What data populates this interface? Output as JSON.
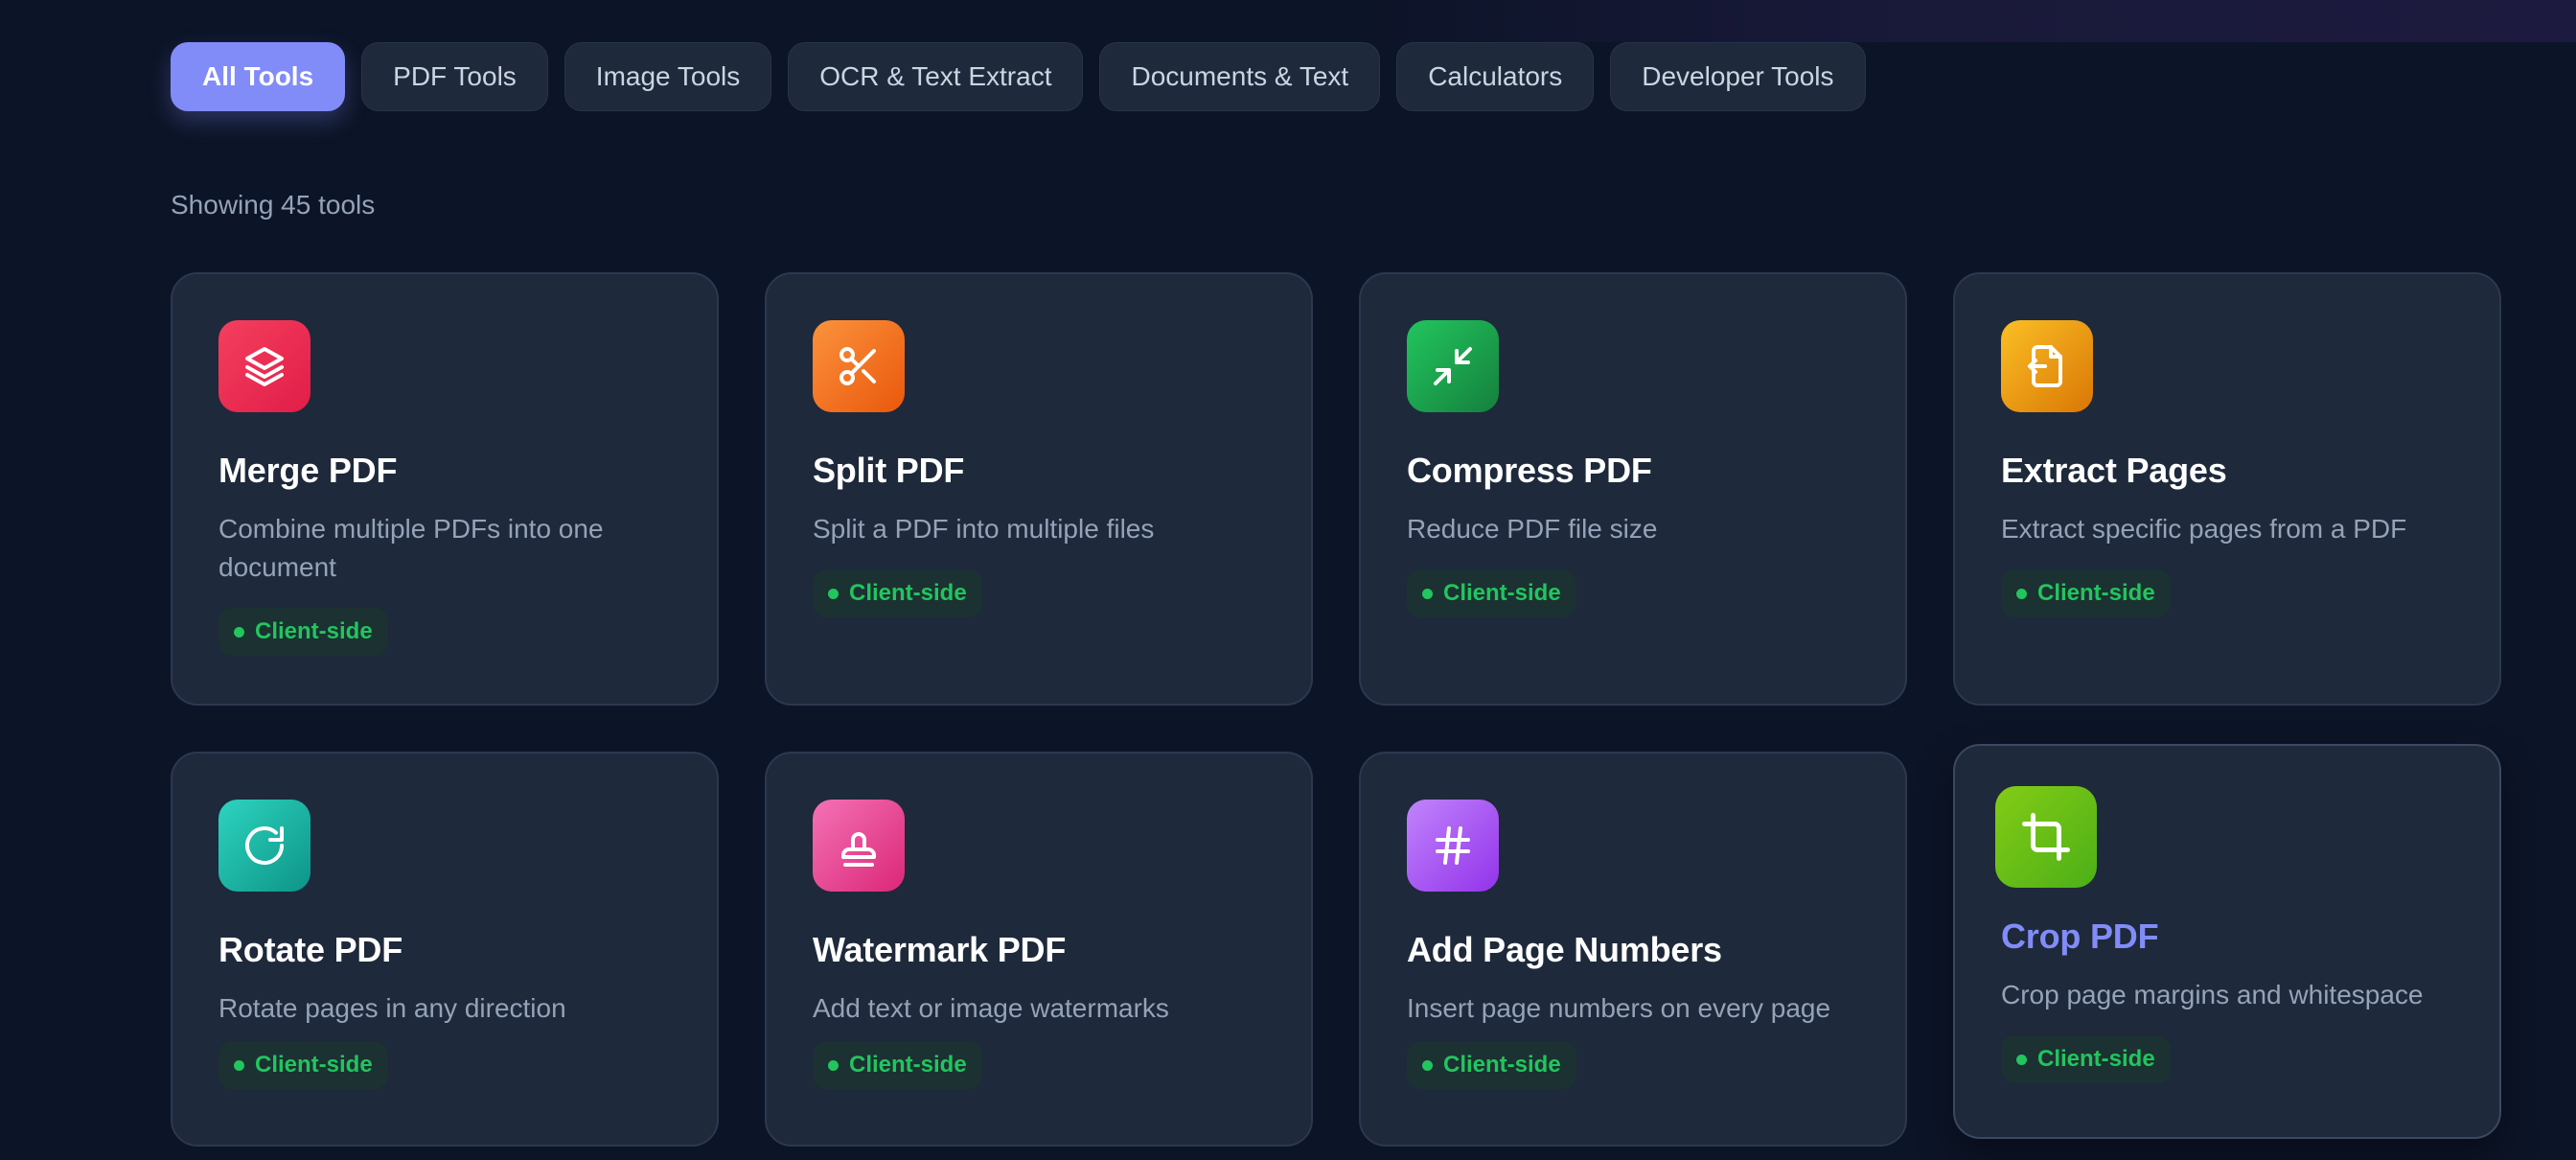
{
  "tabs": [
    {
      "label": "All Tools",
      "active": true
    },
    {
      "label": "PDF Tools",
      "active": false
    },
    {
      "label": "Image Tools",
      "active": false
    },
    {
      "label": "OCR & Text Extract",
      "active": false
    },
    {
      "label": "Documents & Text",
      "active": false
    },
    {
      "label": "Calculators",
      "active": false
    },
    {
      "label": "Developer Tools",
      "active": false
    }
  ],
  "results_count_text": "Showing 45 tools",
  "badge_label": "Client-side",
  "colors": {
    "accent": "#818cf8",
    "badge_green": "#22c55e",
    "card_bg": "#1e293b",
    "page_bg": "#0c1427"
  },
  "tools": [
    {
      "title": "Merge PDF",
      "description": "Combine multiple PDFs into one document",
      "badge": "Client-side",
      "icon": "layers-icon",
      "icon_color": "#e11d48"
    },
    {
      "title": "Split PDF",
      "description": "Split a PDF into multiple files",
      "badge": "Client-side",
      "icon": "scissors-icon",
      "icon_color": "#f97316"
    },
    {
      "title": "Compress PDF",
      "description": "Reduce PDF file size",
      "badge": "Client-side",
      "icon": "minimize-arrows-icon",
      "icon_color": "#16a34a"
    },
    {
      "title": "Extract Pages",
      "description": "Extract specific pages from a PDF",
      "badge": "Client-side",
      "icon": "file-export-icon",
      "icon_color": "#f59e0b"
    },
    {
      "title": "Rotate PDF",
      "description": "Rotate pages in any direction",
      "badge": "Client-side",
      "icon": "rotate-icon",
      "icon_color": "#14b8a6"
    },
    {
      "title": "Watermark PDF",
      "description": "Add text or image watermarks",
      "badge": "Client-side",
      "icon": "stamp-icon",
      "icon_color": "#ec4899"
    },
    {
      "title": "Add Page Numbers",
      "description": "Insert page numbers on every page",
      "badge": "Client-side",
      "icon": "hash-icon",
      "icon_color": "#a855f7"
    },
    {
      "title": "Crop PDF",
      "description": "Crop page margins and whitespace",
      "badge": "Client-side",
      "icon": "crop-icon",
      "icon_color": "#65c318",
      "hovered": true
    }
  ]
}
